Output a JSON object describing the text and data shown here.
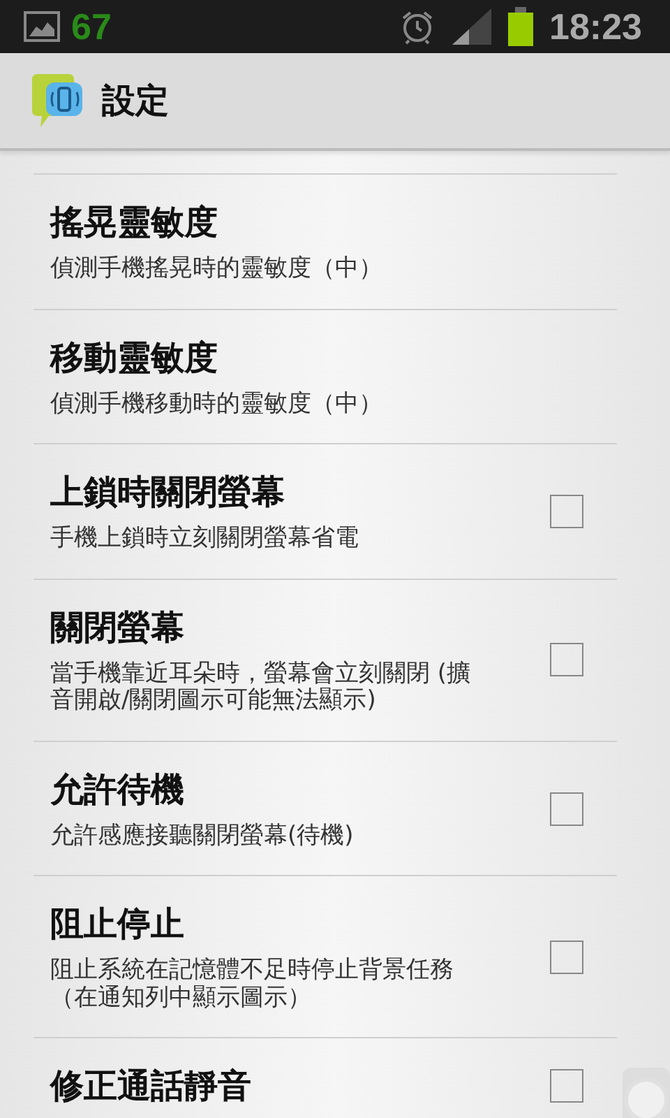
{
  "status_bar": {
    "notification_count": "67",
    "time": "18:23"
  },
  "action_bar": {
    "title": "設定"
  },
  "settings": [
    {
      "kind": "plain",
      "title": "搖晃靈敏度",
      "summary": "偵測手機搖晃時的靈敏度（中）"
    },
    {
      "kind": "plain",
      "title": "移動靈敏度",
      "summary": "偵測手機移動時的靈敏度（中）"
    },
    {
      "kind": "checkbox",
      "title": "上鎖時關閉螢幕",
      "summary": "手機上鎖時立刻關閉螢幕省電",
      "checked": false
    },
    {
      "kind": "checkbox",
      "title": "關閉螢幕",
      "summary": "當手機靠近耳朵時，螢幕會立刻關閉 (擴音開啟/關閉圖示可能無法顯示)",
      "checked": false
    },
    {
      "kind": "checkbox",
      "title": "允許待機",
      "summary": "允許感應接聽關閉螢幕(待機)",
      "checked": false
    },
    {
      "kind": "checkbox",
      "title": "阻止停止",
      "summary": "阻止系統在記憶體不足時停止背景任務（在通知列中顯示圖示）",
      "checked": false
    },
    {
      "kind": "checkbox",
      "title": "修正通話靜音",
      "checked": false
    }
  ]
}
